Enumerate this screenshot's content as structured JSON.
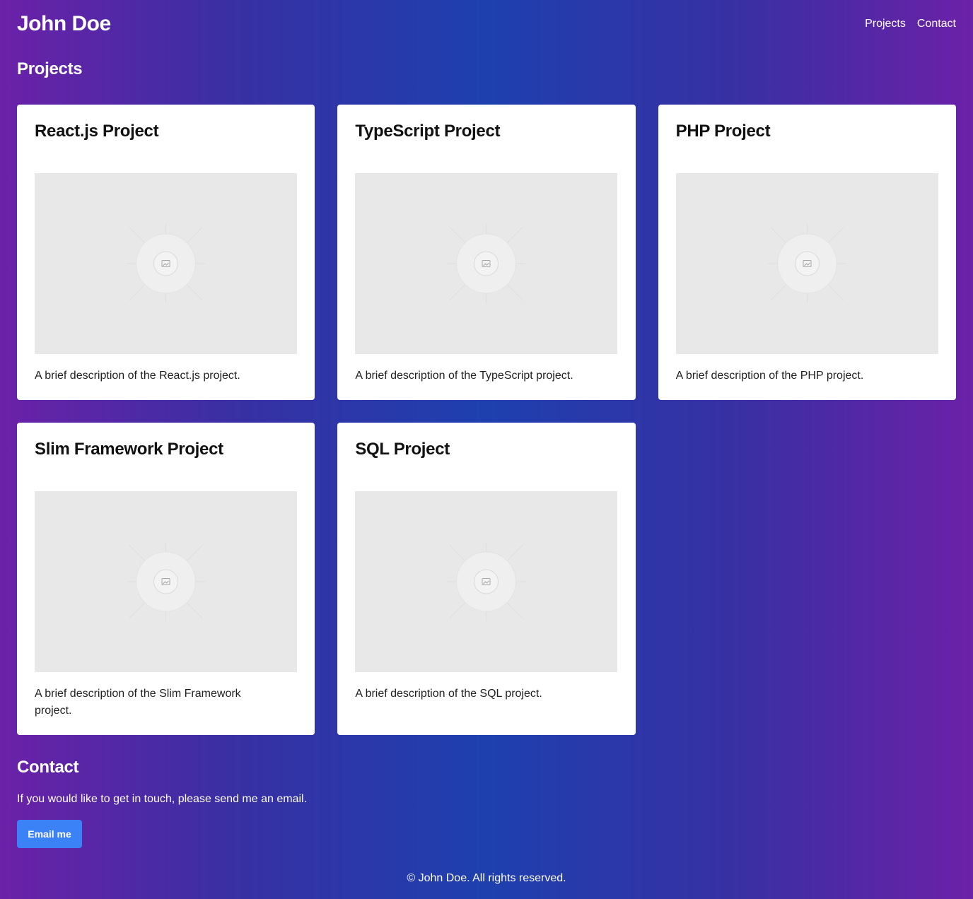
{
  "header": {
    "brand": "John Doe",
    "nav": [
      {
        "label": "Projects"
      },
      {
        "label": "Contact"
      }
    ]
  },
  "projects": {
    "title": "Projects",
    "items": [
      {
        "title": "React.js Project",
        "description": "A brief description of the React.js project.",
        "image_icon": "image-placeholder-icon"
      },
      {
        "title": "TypeScript Project",
        "description": "A brief description of the TypeScript project.",
        "image_icon": "image-placeholder-icon"
      },
      {
        "title": "PHP Project",
        "description": "A brief description of the PHP project.",
        "image_icon": "image-placeholder-icon"
      },
      {
        "title": "Slim Framework Project",
        "description": "A brief description of the Slim Framework project.",
        "image_icon": "image-placeholder-icon"
      },
      {
        "title": "SQL Project",
        "description": "A brief description of the SQL project.",
        "image_icon": "image-placeholder-icon"
      }
    ]
  },
  "contact": {
    "title": "Contact",
    "text": "If you would like to get in touch, please send me an email.",
    "button_label": "Email me"
  },
  "footer": {
    "text": "© John Doe. All rights reserved."
  },
  "colors": {
    "gradient_edge": "#6b21a8",
    "gradient_center": "#1e40af",
    "button": "#3b82f6",
    "card": "#ffffff",
    "placeholder": "#e8e8e8"
  }
}
